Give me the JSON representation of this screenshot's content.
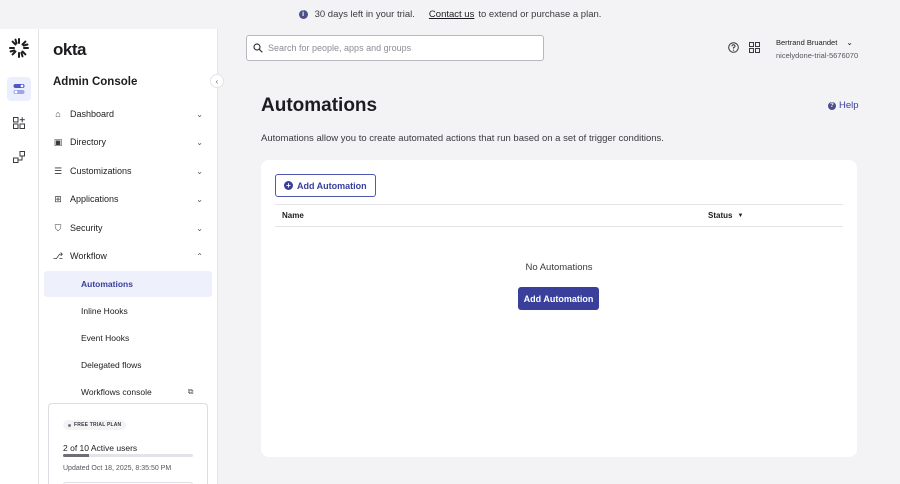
{
  "banner": {
    "message": "30 days left in your trial.",
    "contact_link": "Contact us",
    "suffix": "to extend or purchase a plan."
  },
  "brand": {
    "logo_text": "okta"
  },
  "sidebar": {
    "title": "Admin Console",
    "items": [
      {
        "label": "Dashboard",
        "icon": "home-icon"
      },
      {
        "label": "Directory",
        "icon": "directory-icon"
      },
      {
        "label": "Customizations",
        "icon": "customizations-icon"
      },
      {
        "label": "Applications",
        "icon": "applications-icon"
      },
      {
        "label": "Security",
        "icon": "shield-icon"
      },
      {
        "label": "Workflow",
        "icon": "workflow-icon"
      }
    ],
    "workflow_subitems": [
      {
        "label": "Automations",
        "active": true
      },
      {
        "label": "Inline Hooks"
      },
      {
        "label": "Event Hooks"
      },
      {
        "label": "Delegated flows"
      },
      {
        "label": "Workflows console",
        "external": true
      }
    ]
  },
  "trial_card": {
    "badge": "FREE TRIAL PLAN",
    "users_text": "2 of 10 Active users",
    "active_users": 2,
    "max_users": 10,
    "updated_text": "Updated Oct 18, 2025, 8:35:50 PM"
  },
  "search": {
    "placeholder": "Search for people, apps and groups"
  },
  "user": {
    "name": "Bertrand Bruandet",
    "org": "nicelydone-trial-5676070"
  },
  "main": {
    "title": "Automations",
    "help_label": "Help",
    "description": "Automations allow you to create automated actions that run based on a set of trigger conditions.",
    "add_button_label": "Add Automation",
    "table": {
      "columns": [
        "Name",
        "Status"
      ],
      "empty_text": "No Automations"
    },
    "empty_add_button_label": "Add Automation"
  },
  "colors": {
    "accent": "#3a3f9c",
    "background": "#f3f3f5"
  }
}
